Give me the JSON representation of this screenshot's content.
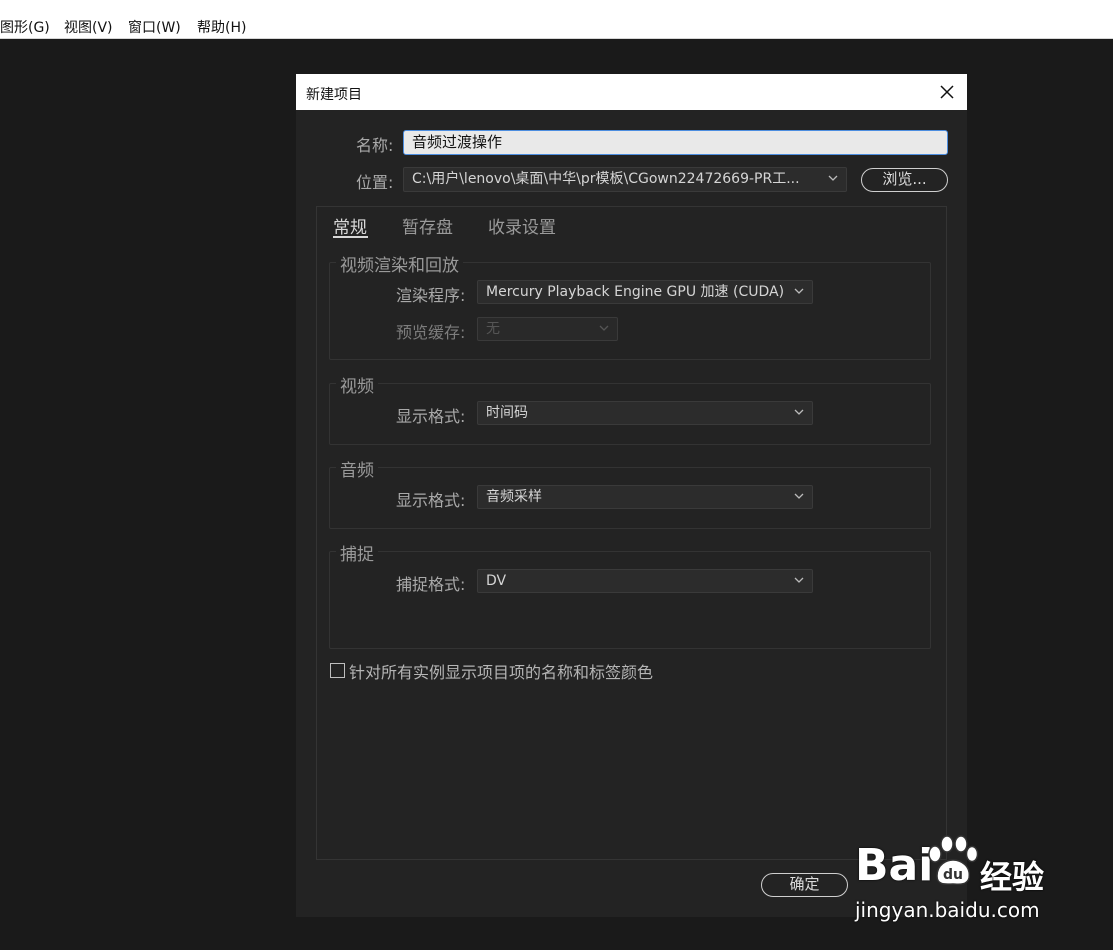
{
  "menubar": {
    "items": [
      "图形(G)",
      "视图(V)",
      "窗口(W)",
      "帮助(H)"
    ]
  },
  "dialog": {
    "title": "新建项目",
    "name_label": "名称:",
    "name_value": "音频过渡操作",
    "location_label": "位置:",
    "location_value": "C:\\用户\\lenovo\\桌面\\中华\\pr模板\\CGown22472669-PR工...",
    "browse_label": "浏览...",
    "tabs": [
      "常规",
      "暂存盘",
      "收录设置"
    ],
    "groups": {
      "video_render": {
        "title": "视频渲染和回放",
        "renderer_label": "渲染程序:",
        "renderer_value": "Mercury Playback Engine GPU 加速 (CUDA)",
        "preview_cache_label": "预览缓存:",
        "preview_cache_value": "无"
      },
      "video": {
        "title": "视频",
        "display_format_label": "显示格式:",
        "display_format_value": "时间码"
      },
      "audio": {
        "title": "音频",
        "display_format_label": "显示格式:",
        "display_format_value": "音频采样"
      },
      "capture": {
        "title": "捕捉",
        "capture_format_label": "捕捉格式:",
        "capture_format_value": "DV"
      }
    },
    "checkbox_label": "针对所有实例显示项目项的名称和标签颜色",
    "ok_label": "确定"
  },
  "watermark": {
    "brand": "Bai",
    "brand_suffix": "经验",
    "url": "jingyan.baidu.com"
  },
  "colors": {
    "background": "#1a1a1a",
    "dialog_bg": "#232323",
    "focus_border": "#4d8ee0"
  }
}
